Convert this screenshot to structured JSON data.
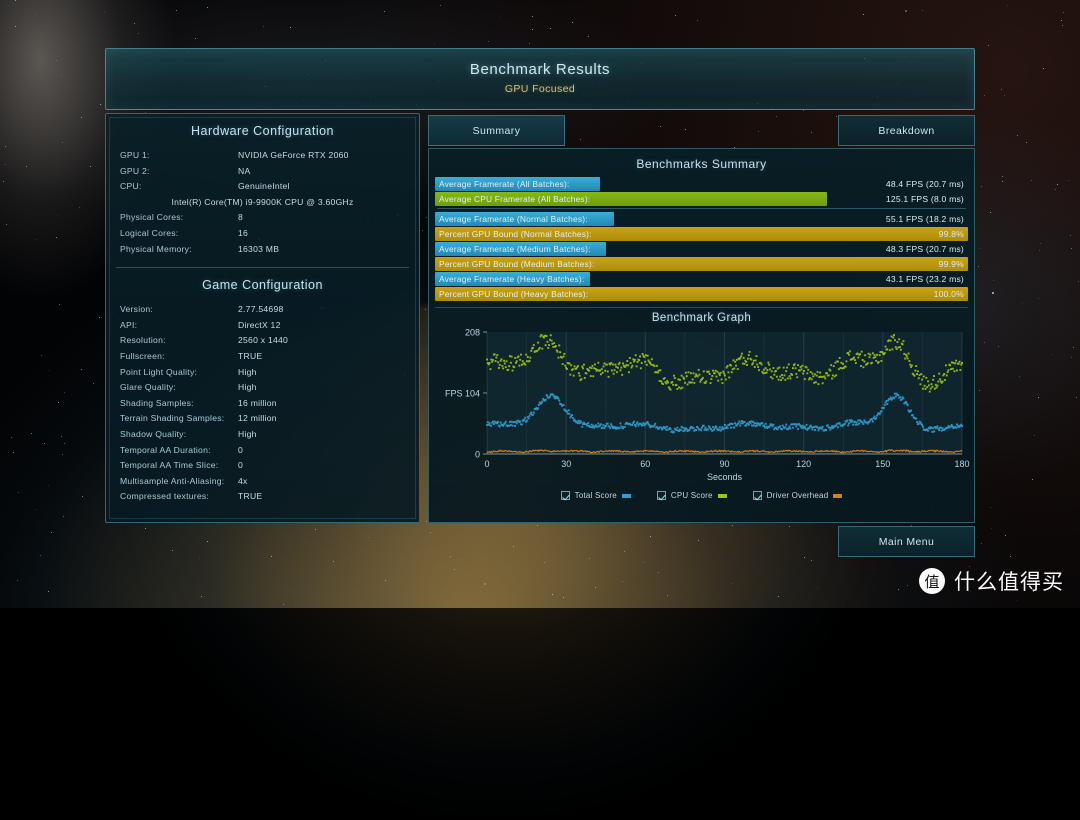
{
  "header": {
    "title": "Benchmark Results",
    "subtitle": "GPU Focused"
  },
  "tabs": [
    {
      "label": "Summary",
      "active": true
    },
    {
      "label": "Breakdown",
      "active": false
    }
  ],
  "hardware": {
    "heading": "Hardware Configuration",
    "rows": [
      {
        "key": "GPU 1:",
        "value": "NVIDIA GeForce RTX 2060"
      },
      {
        "key": "GPU 2:",
        "value": "NA"
      },
      {
        "key": "CPU:",
        "value": "GenuineIntel"
      },
      {
        "key": "",
        "value": "Intel(R) Core(TM) i9-9900K CPU @ 3.60GHz",
        "center": true
      },
      {
        "key": "Physical Cores:",
        "value": "8"
      },
      {
        "key": "Logical Cores:",
        "value": "16"
      },
      {
        "key": "Physical Memory:",
        "value": "16303  MB"
      }
    ]
  },
  "game": {
    "heading": "Game Configuration",
    "rows": [
      {
        "key": "Version:",
        "value": "2.77.54698"
      },
      {
        "key": "API:",
        "value": "DirectX 12"
      },
      {
        "key": "Resolution:",
        "value": "2560 x 1440"
      },
      {
        "key": "Fullscreen:",
        "value": "TRUE"
      },
      {
        "key": "Point Light Quality:",
        "value": "High"
      },
      {
        "key": "Glare Quality:",
        "value": "High"
      },
      {
        "key": "Shading Samples:",
        "value": "16 million"
      },
      {
        "key": "Terrain Shading Samples:",
        "value": "12 million"
      },
      {
        "key": "Shadow Quality:",
        "value": "High"
      },
      {
        "key": "Temporal AA Duration:",
        "value": "0"
      },
      {
        "key": "Temporal AA Time Slice:",
        "value": "0"
      },
      {
        "key": "Multisample Anti-Aliasing:",
        "value": "4x"
      },
      {
        "key": "Compressed textures:",
        "value": "TRUE"
      }
    ]
  },
  "summary": {
    "title": "Benchmarks Summary",
    "rows": [
      {
        "label": "Average Framerate (All Batches):",
        "value": "48.4 FPS (20.7 ms)",
        "color": "blue",
        "fill_pct": 31
      },
      {
        "label": "Average CPU Framerate (All Batches):",
        "value": "125.1 FPS (8.0 ms)",
        "color": "green",
        "fill_pct": 73.5
      },
      {
        "separator": true
      },
      {
        "label": "Average Framerate (Normal Batches):",
        "value": "55.1 FPS (18.2 ms)",
        "color": "blue",
        "fill_pct": 33.5
      },
      {
        "label": "Percent GPU Bound (Normal Batches):",
        "value": "99.8%",
        "color": "gold",
        "fill_pct": 100
      },
      {
        "label": "Average Framerate (Medium Batches):",
        "value": "48.3 FPS (20.7 ms)",
        "color": "blue",
        "fill_pct": 32
      },
      {
        "label": "Percent GPU Bound (Medium Batches):",
        "value": "99.9%",
        "color": "gold",
        "fill_pct": 100
      },
      {
        "label": "Average Framerate (Heavy Batches):",
        "value": "43.1 FPS (23.2 ms)",
        "color": "blue",
        "fill_pct": 29
      },
      {
        "label": "Percent GPU Bound (Heavy Batches):",
        "value": "100.0%",
        "color": "gold",
        "fill_pct": 100
      }
    ]
  },
  "chart_data": {
    "type": "scatter",
    "title": "Benchmark Graph",
    "xlabel": "Seconds",
    "ylabel": "FPS",
    "xlim": [
      0,
      180
    ],
    "ylim": [
      0,
      208
    ],
    "xticks": [
      0,
      30,
      60,
      90,
      120,
      150,
      180
    ],
    "yticks": [
      0,
      104,
      208
    ],
    "ytick_labels": [
      "0",
      "FPS 104",
      "208"
    ],
    "grid": true,
    "legend_position": "bottom",
    "series": [
      {
        "name": "Total Score",
        "color": "#2e9fd0",
        "checked": true,
        "mean": 48,
        "min": 28,
        "max": 112,
        "description": "Blue scatter band oscillating around 45-55 FPS with spikes near 100 FPS at 20-30s and 150-160s"
      },
      {
        "name": "CPU Score",
        "color": "#9ec411",
        "checked": true,
        "mean": 125,
        "min": 90,
        "max": 205,
        "description": "Green scatter band oscillating around 130-160 FPS with peaks to 205 FPS"
      },
      {
        "name": "Driver Overhead",
        "color": "#d98218",
        "checked": true,
        "mean": 3,
        "min": 0,
        "max": 14,
        "description": "Orange near-flat line just above 0 FPS"
      }
    ]
  },
  "footer": {
    "main_menu_label": "Main Menu"
  },
  "watermark": {
    "logo_glyph": "值",
    "text": "什么值得买"
  },
  "colors": {
    "accent_teal": "#5aa5b4",
    "gold": "#c9a315",
    "green": "#86b817",
    "blue": "#3aaed6",
    "orange": "#d98218"
  }
}
